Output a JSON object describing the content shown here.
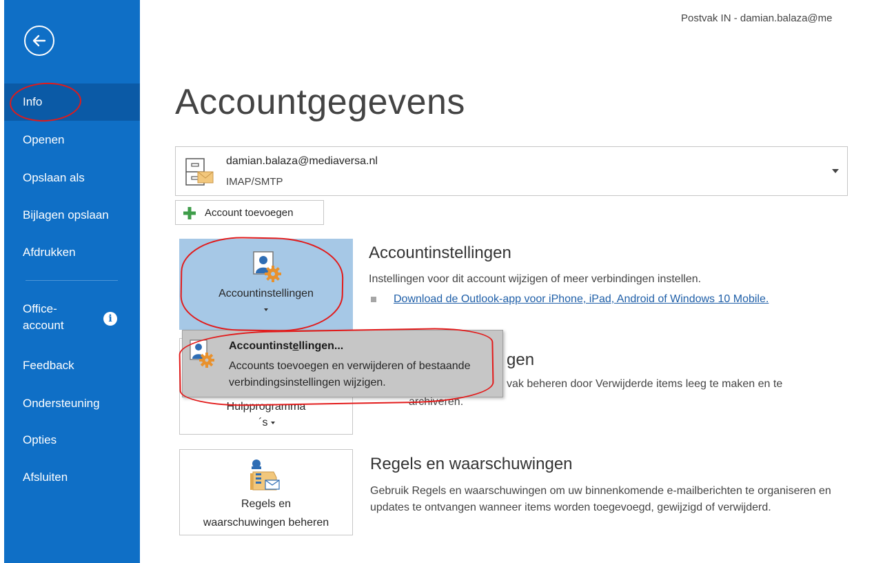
{
  "window": {
    "title": "Postvak IN - damian.balaza@me"
  },
  "sidebar": {
    "items": [
      {
        "label": "Info",
        "active": true
      },
      {
        "label": "Openen"
      },
      {
        "label": "Opslaan als"
      },
      {
        "label": "Bijlagen opslaan"
      },
      {
        "label": "Afdrukken"
      },
      {
        "label": "Office-\naccount"
      },
      {
        "label": "Feedback"
      },
      {
        "label": "Ondersteuning"
      },
      {
        "label": "Opties"
      },
      {
        "label": "Afsluiten"
      }
    ],
    "office_account_line1": "Office-",
    "office_account_line2": "account"
  },
  "main": {
    "title": "Accountgegevens",
    "account": {
      "email": "damian.balaza@mediaversa.nl",
      "type": "IMAP/SMTP"
    },
    "add_account_label": "Account toevoegen",
    "account_settings": {
      "tile_label": "Accountinstellingen",
      "heading": "Accountinstellingen",
      "description": "Instellingen voor dit account wijzigen of meer verbindingen instellen.",
      "link": "Download de Outlook-app voor iPhone, iPad, Android of Windows 10 Mobile."
    },
    "tools": {
      "tile_label_line1": "Hulpprogramma",
      "tile_label_line2": "´s",
      "heading_visible": "gen",
      "description_line1_visible": "vak beheren door Verwijderde items leeg te maken en te",
      "description_line2_visible": "archiveren."
    },
    "rules": {
      "tile_label_line1": "Regels en",
      "tile_label_line2": "waarschuwingen beheren",
      "heading": "Regels en waarschuwingen",
      "description": "Gebruik Regels en waarschuwingen om uw binnenkomende e-mailberichten te organiseren en updates te ontvangen wanneer items worden toegevoegd, gewijzigd of verwijderd."
    }
  },
  "dropdown": {
    "title_pre": "Accountinst",
    "title_underlined": "e",
    "title_post": "llingen...",
    "description": "Accounts toevoegen en verwijderen of bestaande verbindingsinstellingen wijzigen."
  },
  "colors": {
    "sidebar": "#0f6fc6",
    "sidebar_active": "#0b5aa6",
    "tile_selected": "#a6c8e6",
    "annotation": "#e21a1a"
  }
}
